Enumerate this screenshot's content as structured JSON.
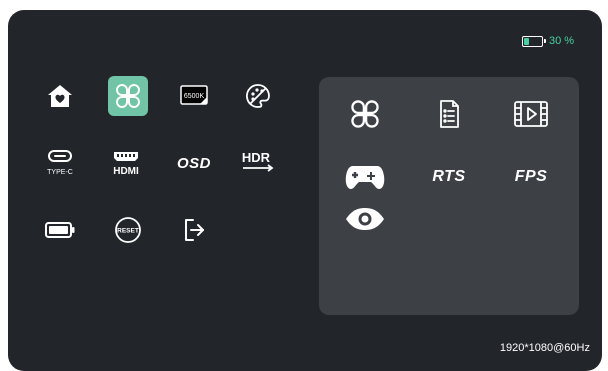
{
  "status": {
    "battery_percent_label": "30 %",
    "battery_level": 0.3,
    "accent_color": "#47d1a2"
  },
  "main_menu": {
    "items": [
      {
        "name": "home-icon",
        "selected": false
      },
      {
        "name": "game-mode-icon",
        "selected": true
      },
      {
        "name": "color-temperature-icon",
        "label": "6500K"
      },
      {
        "name": "color-palette-icon"
      },
      {
        "name": "type-c-icon",
        "label": "TYPE-C"
      },
      {
        "name": "hdmi-icon",
        "label": "HDMI"
      },
      {
        "name": "osd-icon",
        "label": "OSD"
      },
      {
        "name": "hdr-icon",
        "label": "HDR"
      },
      {
        "name": "battery-icon"
      },
      {
        "name": "reset-icon",
        "label": "RESET"
      },
      {
        "name": "exit-icon"
      }
    ]
  },
  "submenu": {
    "items": [
      {
        "name": "standard-mode-icon"
      },
      {
        "name": "document-mode-icon"
      },
      {
        "name": "movie-mode-icon"
      },
      {
        "name": "game-plus-icon"
      },
      {
        "name": "rts-icon",
        "label": "RTS"
      },
      {
        "name": "fps-icon",
        "label": "FPS"
      },
      {
        "name": "eye-care-icon"
      }
    ]
  },
  "footer": {
    "resolution": "1920*1080@60Hz"
  }
}
